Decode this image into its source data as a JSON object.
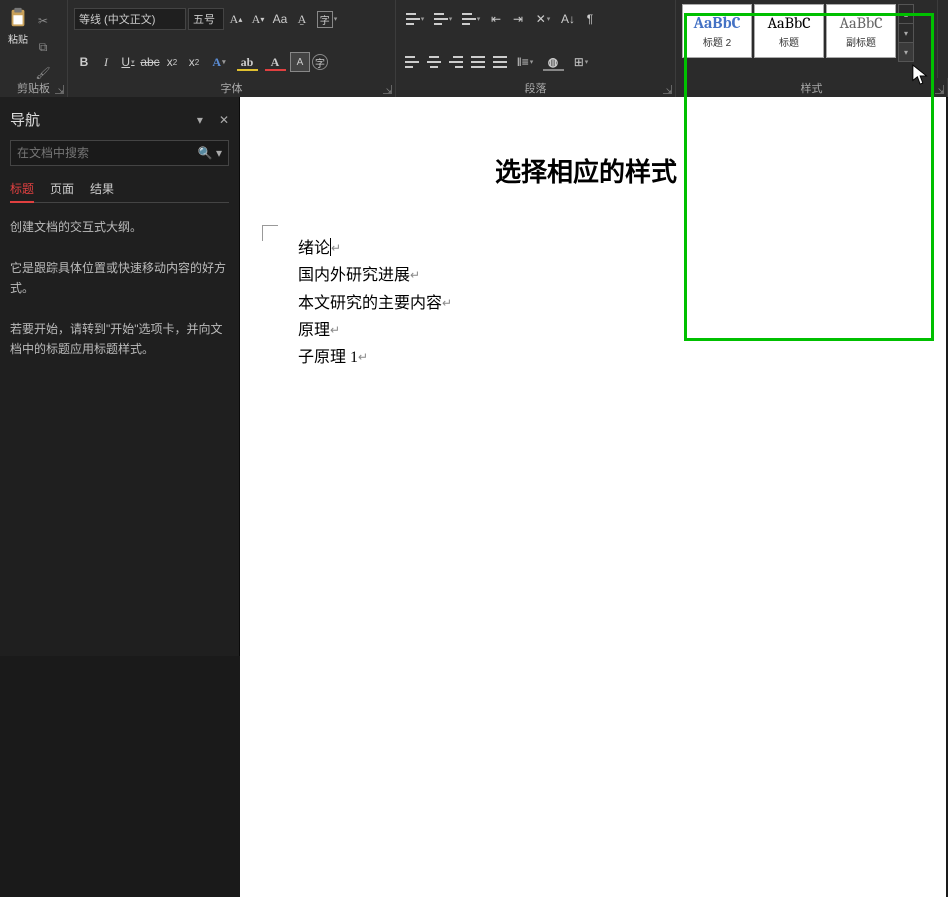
{
  "ribbon": {
    "clipboard": {
      "paste_label": "粘贴",
      "group_label": "剪贴板"
    },
    "font": {
      "group_label": "字体",
      "font_name": "等线 (中文正文)",
      "font_size": "五号"
    },
    "paragraph": {
      "group_label": "段落"
    },
    "styles": {
      "group_label": "样式",
      "cards": [
        {
          "sample": "AaBbC",
          "name": "标题 2"
        },
        {
          "sample": "AaBbC",
          "name": "标题"
        },
        {
          "sample": "AaBbC",
          "name": "副标题"
        }
      ]
    }
  },
  "nav": {
    "title": "导航",
    "search_placeholder": "在文档中搜索",
    "tabs": {
      "headings": "标题",
      "pages": "页面",
      "results": "结果"
    },
    "help1": "创建文档的交互式大纲。",
    "help2": "它是跟踪具体位置或快速移动内容的好方式。",
    "help3": "若要开始，请转到\"开始\"选项卡，并向文档中的标题应用标题样式。"
  },
  "doc": {
    "title": "选择相应的样式",
    "lines": [
      "绪论",
      "国内外研究进展",
      "本文研究的主要内容",
      "原理",
      "子原理 1"
    ],
    "pilcrow": "↵"
  }
}
